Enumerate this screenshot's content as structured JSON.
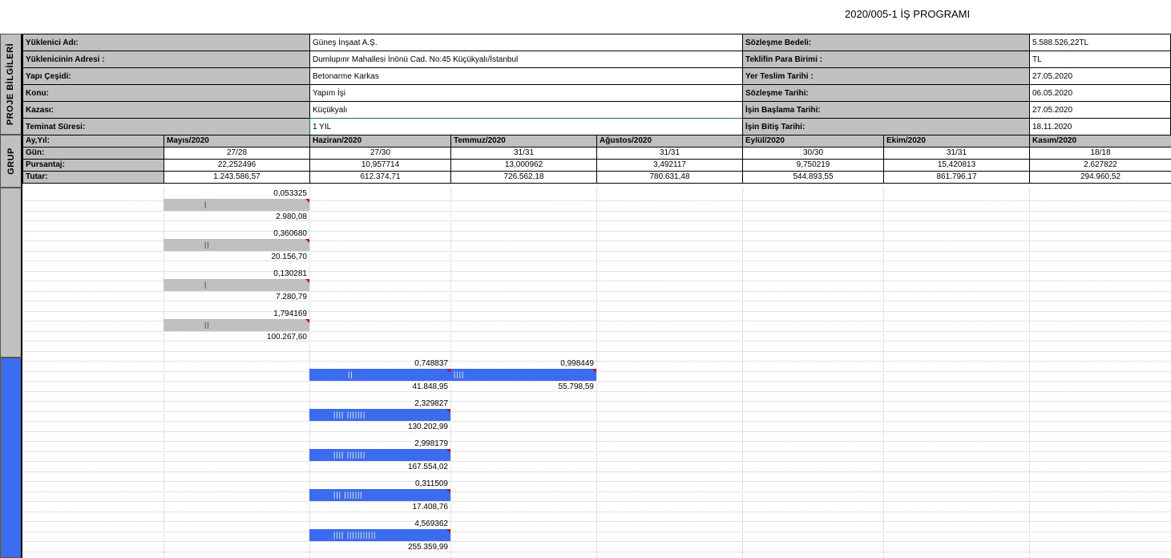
{
  "title": "2020/005-1 İŞ PROGRAMI",
  "side_labels": {
    "project": "PROJE BİLGİLERİ",
    "group_header": "GRUP"
  },
  "project_info": {
    "left": [
      {
        "label": "Yüklenici Adı:",
        "value": "Güneş İnşaat A.Ş."
      },
      {
        "label": "Yüklenicinin Adresi :",
        "value": "Dumlupınr Mahallesi İnönü Cad. No:45 Küçükyalı/İstanbul"
      },
      {
        "label": "Yapı Çeşidi:",
        "value": "Betonarme Karkas"
      },
      {
        "label": "Konu:",
        "value": "Yapım İşi"
      },
      {
        "label": "Kazası:",
        "value": "Küçükyalı"
      },
      {
        "label": "Teminat Süresi:",
        "value": "1 YIL"
      }
    ],
    "right": [
      {
        "label": "Sözleşme Bedeli:",
        "value": "5.588.526,22TL"
      },
      {
        "label": "Teklifin Para Birimi :",
        "value": "TL"
      },
      {
        "label": "Yer Teslim Tarihi :",
        "value": "27.05.2020"
      },
      {
        "label": "Sözleşme Tarihi:",
        "value": "06.05.2020"
      },
      {
        "label": "İşin Başlama Tarihi:",
        "value": "27.05.2020"
      },
      {
        "label": "İşin Bitiş Tarihi:",
        "value": "18.11.2020"
      }
    ]
  },
  "months_table": {
    "row_labels": [
      "Ay,Yıl:",
      "Gün:",
      "Pursantaj:",
      "Tutar:"
    ],
    "months": [
      {
        "name": "Mayıs/2020",
        "gun": "27/28",
        "pursantaj": "22,252496",
        "tutar": "1.243.586,57"
      },
      {
        "name": "Haziran/2020",
        "gun": "27/30",
        "pursantaj": "10,957714",
        "tutar": "612.374,71"
      },
      {
        "name": "Temmuz/2020",
        "gun": "31/31",
        "pursantaj": "13,000962",
        "tutar": "726.562,18"
      },
      {
        "name": "Ağustos/2020",
        "gun": "31/31",
        "pursantaj": "3,492117",
        "tutar": "780.631,48"
      },
      {
        "name": "Eylül/2020",
        "gun": "30/30",
        "pursantaj": "9,750219",
        "tutar": "544.893,55"
      },
      {
        "name": "Ekim/2020",
        "gun": "31/31",
        "pursantaj": "15,420813",
        "tutar": "861.796,17"
      },
      {
        "name": "Kasım/2020",
        "gun": "18/18",
        "pursantaj": "2,627822",
        "tutar": "294.960,52"
      }
    ]
  },
  "gantt": {
    "group1_color": "#c0c0c0",
    "group2_color": "#3b6cf0",
    "tasks": [
      {
        "group": 1,
        "segments": [
          {
            "month": 0,
            "pct": "0,053325",
            "amount": "2.980,08",
            "ticks": "|"
          }
        ]
      },
      {
        "group": 1,
        "segments": [
          {
            "month": 0,
            "pct": "0,360680",
            "amount": "20.156,70",
            "ticks": "||"
          }
        ]
      },
      {
        "group": 1,
        "segments": [
          {
            "month": 0,
            "pct": "0,130281",
            "amount": "7.280,79",
            "ticks": "|"
          }
        ]
      },
      {
        "group": 1,
        "segments": [
          {
            "month": 0,
            "pct": "1,794169",
            "amount": "100.267,60",
            "ticks": "||"
          }
        ]
      },
      {
        "group": 2,
        "segments": [
          {
            "month": 1,
            "pct": "0,748837",
            "amount": "41.848,95",
            "ticks": "||"
          },
          {
            "month": 2,
            "pct": "0,998449",
            "amount": "55.798,59",
            "ticks": "||||"
          }
        ]
      },
      {
        "group": 2,
        "segments": [
          {
            "month": 1,
            "pct": "2,329827",
            "amount": "130.202,99",
            "ticks": "||||        |||||||"
          }
        ]
      },
      {
        "group": 2,
        "segments": [
          {
            "month": 1,
            "pct": "2,998179",
            "amount": "167.554,02",
            "ticks": "||||        |||||||"
          }
        ]
      },
      {
        "group": 2,
        "segments": [
          {
            "month": 1,
            "pct": "0,311509",
            "amount": "17.408,76",
            "ticks": "|||         |||||||"
          }
        ]
      },
      {
        "group": 2,
        "segments": [
          {
            "month": 1,
            "pct": "4,569362",
            "amount": "255.359,99",
            "ticks": "||||    |||||||||||"
          }
        ]
      }
    ]
  }
}
